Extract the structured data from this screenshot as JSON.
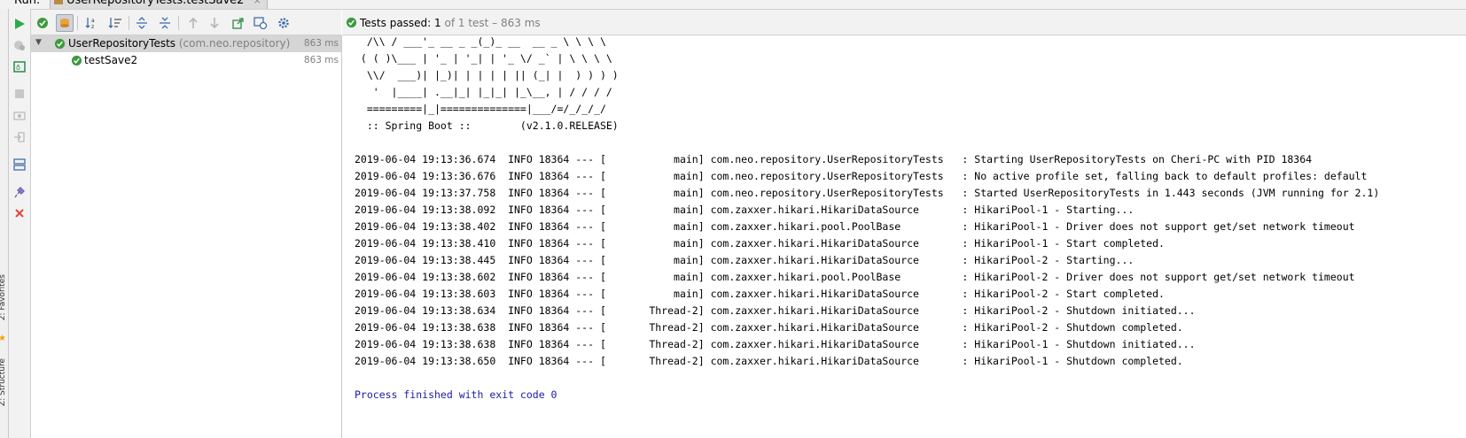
{
  "run_bar": {
    "label": "Run:",
    "tab_title": "UserRepositoryTests.testSave2",
    "tab_close": "×"
  },
  "sidebar_strip": {
    "favorites_label": "2: Favorites",
    "structure_label": "Z: Structure"
  },
  "tree": {
    "suite": {
      "name": "UserRepositoryTests",
      "package": "(com.neo.repository)",
      "time": "863 ms"
    },
    "test": {
      "name": "testSave2",
      "time": "863 ms"
    }
  },
  "status": {
    "prefix": "Tests passed: ",
    "passed_count": "1",
    "detail": " of 1 test – 863 ms"
  },
  "console": {
    "banner": [
      "  /\\\\ / ___'_ __ _ _(_)_ __  __ _ \\ \\ \\ \\",
      " ( ( )\\___ | '_ | '_| | '_ \\/ _` | \\ \\ \\ \\",
      "  \\\\/  ___)| |_)| | | | | || (_| |  ) ) ) )",
      "   '  |____| .__|_| |_|_| |_\\__, | / / / /",
      "  =========|_|==============|___/=/_/_/_/",
      "  :: Spring Boot ::        (v2.1.0.RELEASE)"
    ],
    "log_lines": [
      "2019-06-04 19:13:36.674  INFO 18364 --- [           main] com.neo.repository.UserRepositoryTests   : Starting UserRepositoryTests on Cheri-PC with PID 18364",
      "2019-06-04 19:13:36.676  INFO 18364 --- [           main] com.neo.repository.UserRepositoryTests   : No active profile set, falling back to default profiles: default",
      "2019-06-04 19:13:37.758  INFO 18364 --- [           main] com.neo.repository.UserRepositoryTests   : Started UserRepositoryTests in 1.443 seconds (JVM running for 2.1)",
      "2019-06-04 19:13:38.092  INFO 18364 --- [           main] com.zaxxer.hikari.HikariDataSource       : HikariPool-1 - Starting...",
      "2019-06-04 19:13:38.402  INFO 18364 --- [           main] com.zaxxer.hikari.pool.PoolBase          : HikariPool-1 - Driver does not support get/set network timeout",
      "2019-06-04 19:13:38.410  INFO 18364 --- [           main] com.zaxxer.hikari.HikariDataSource       : HikariPool-1 - Start completed.",
      "2019-06-04 19:13:38.445  INFO 18364 --- [           main] com.zaxxer.hikari.HikariDataSource       : HikariPool-2 - Starting...",
      "2019-06-04 19:13:38.602  INFO 18364 --- [           main] com.zaxxer.hikari.pool.PoolBase          : HikariPool-2 - Driver does not support get/set network timeout",
      "2019-06-04 19:13:38.603  INFO 18364 --- [           main] com.zaxxer.hikari.HikariDataSource       : HikariPool-2 - Start completed.",
      "2019-06-04 19:13:38.634  INFO 18364 --- [       Thread-2] com.zaxxer.hikari.HikariDataSource       : HikariPool-2 - Shutdown initiated...",
      "2019-06-04 19:13:38.638  INFO 18364 --- [       Thread-2] com.zaxxer.hikari.HikariDataSource       : HikariPool-2 - Shutdown completed.",
      "2019-06-04 19:13:38.638  INFO 18364 --- [       Thread-2] com.zaxxer.hikari.HikariDataSource       : HikariPool-1 - Shutdown initiated...",
      "2019-06-04 19:13:38.650  INFO 18364 --- [       Thread-2] com.zaxxer.hikari.HikariDataSource       : HikariPool-1 - Shutdown completed."
    ],
    "exit_message": "Process finished with exit code 0"
  },
  "colors": {
    "pass_green": "#3d9a3d",
    "stop_red": "#e0453c",
    "run_green": "#2eaa4a",
    "exit_text": "#1a1aa6"
  }
}
